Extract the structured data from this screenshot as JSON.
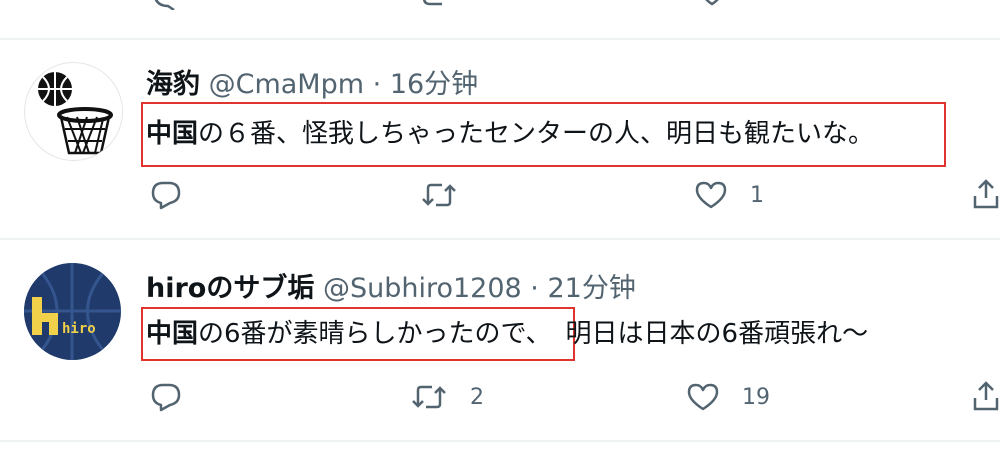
{
  "tweets": [
    {
      "name": "海豹",
      "handle": "@CmaMpm",
      "separator": "·",
      "time": "16分钟",
      "text_bold": "中国",
      "text_rest": "の６番、怪我しちゃったセンターの人、明日も観たいな。",
      "replies": "",
      "retweets": "",
      "likes": "1",
      "avatar_icon": "basketball-hoop-icon"
    },
    {
      "name": "hiroのサブ垢",
      "handle": "@Subhiro1208",
      "separator": "·",
      "time": "21分钟",
      "text_bold": "中国",
      "text_highlighted": "の6番が素晴らしかったので、",
      "text_rest": "明日は日本の6番頑張れ〜",
      "replies": "",
      "retweets": "2",
      "likes": "19",
      "avatar_text": "hiro",
      "avatar_icon": "basketball-logo-icon"
    }
  ],
  "colors": {
    "highlight": "#e0352f",
    "icon": "#536471",
    "divider": "#eff3f4",
    "avatar_navy": "#1f3a6b",
    "avatar_yellow": "#f1d14a"
  }
}
